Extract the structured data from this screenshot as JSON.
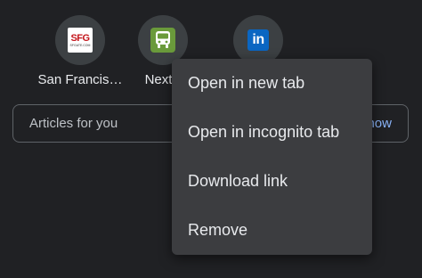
{
  "tiles": [
    {
      "label": "San Francis…",
      "icon": "sfgate-logo-icon",
      "logo_text": "SFG",
      "logo_subtext": "SFGATE.COM"
    },
    {
      "label": "NextB",
      "icon": "nextbus-logo-icon"
    },
    {
      "label": "",
      "icon": "linkedin-logo-icon",
      "logo_text": "in"
    }
  ],
  "articles": {
    "label": "Articles for you",
    "action": "now"
  },
  "context_menu": {
    "items": [
      {
        "label": "Open in new tab"
      },
      {
        "label": "Open in incognito tab"
      },
      {
        "label": "Download link"
      },
      {
        "label": "Remove"
      }
    ]
  },
  "colors": {
    "background": "#202124",
    "tile_circle": "#3c4043",
    "menu_background": "#3c3d40",
    "text_primary": "#e8eaed",
    "link_blue": "#8ab4f8",
    "sfgate_red": "#c4161c",
    "nextbus_green": "#6a9a3b",
    "linkedin_blue": "#0a66c2"
  }
}
